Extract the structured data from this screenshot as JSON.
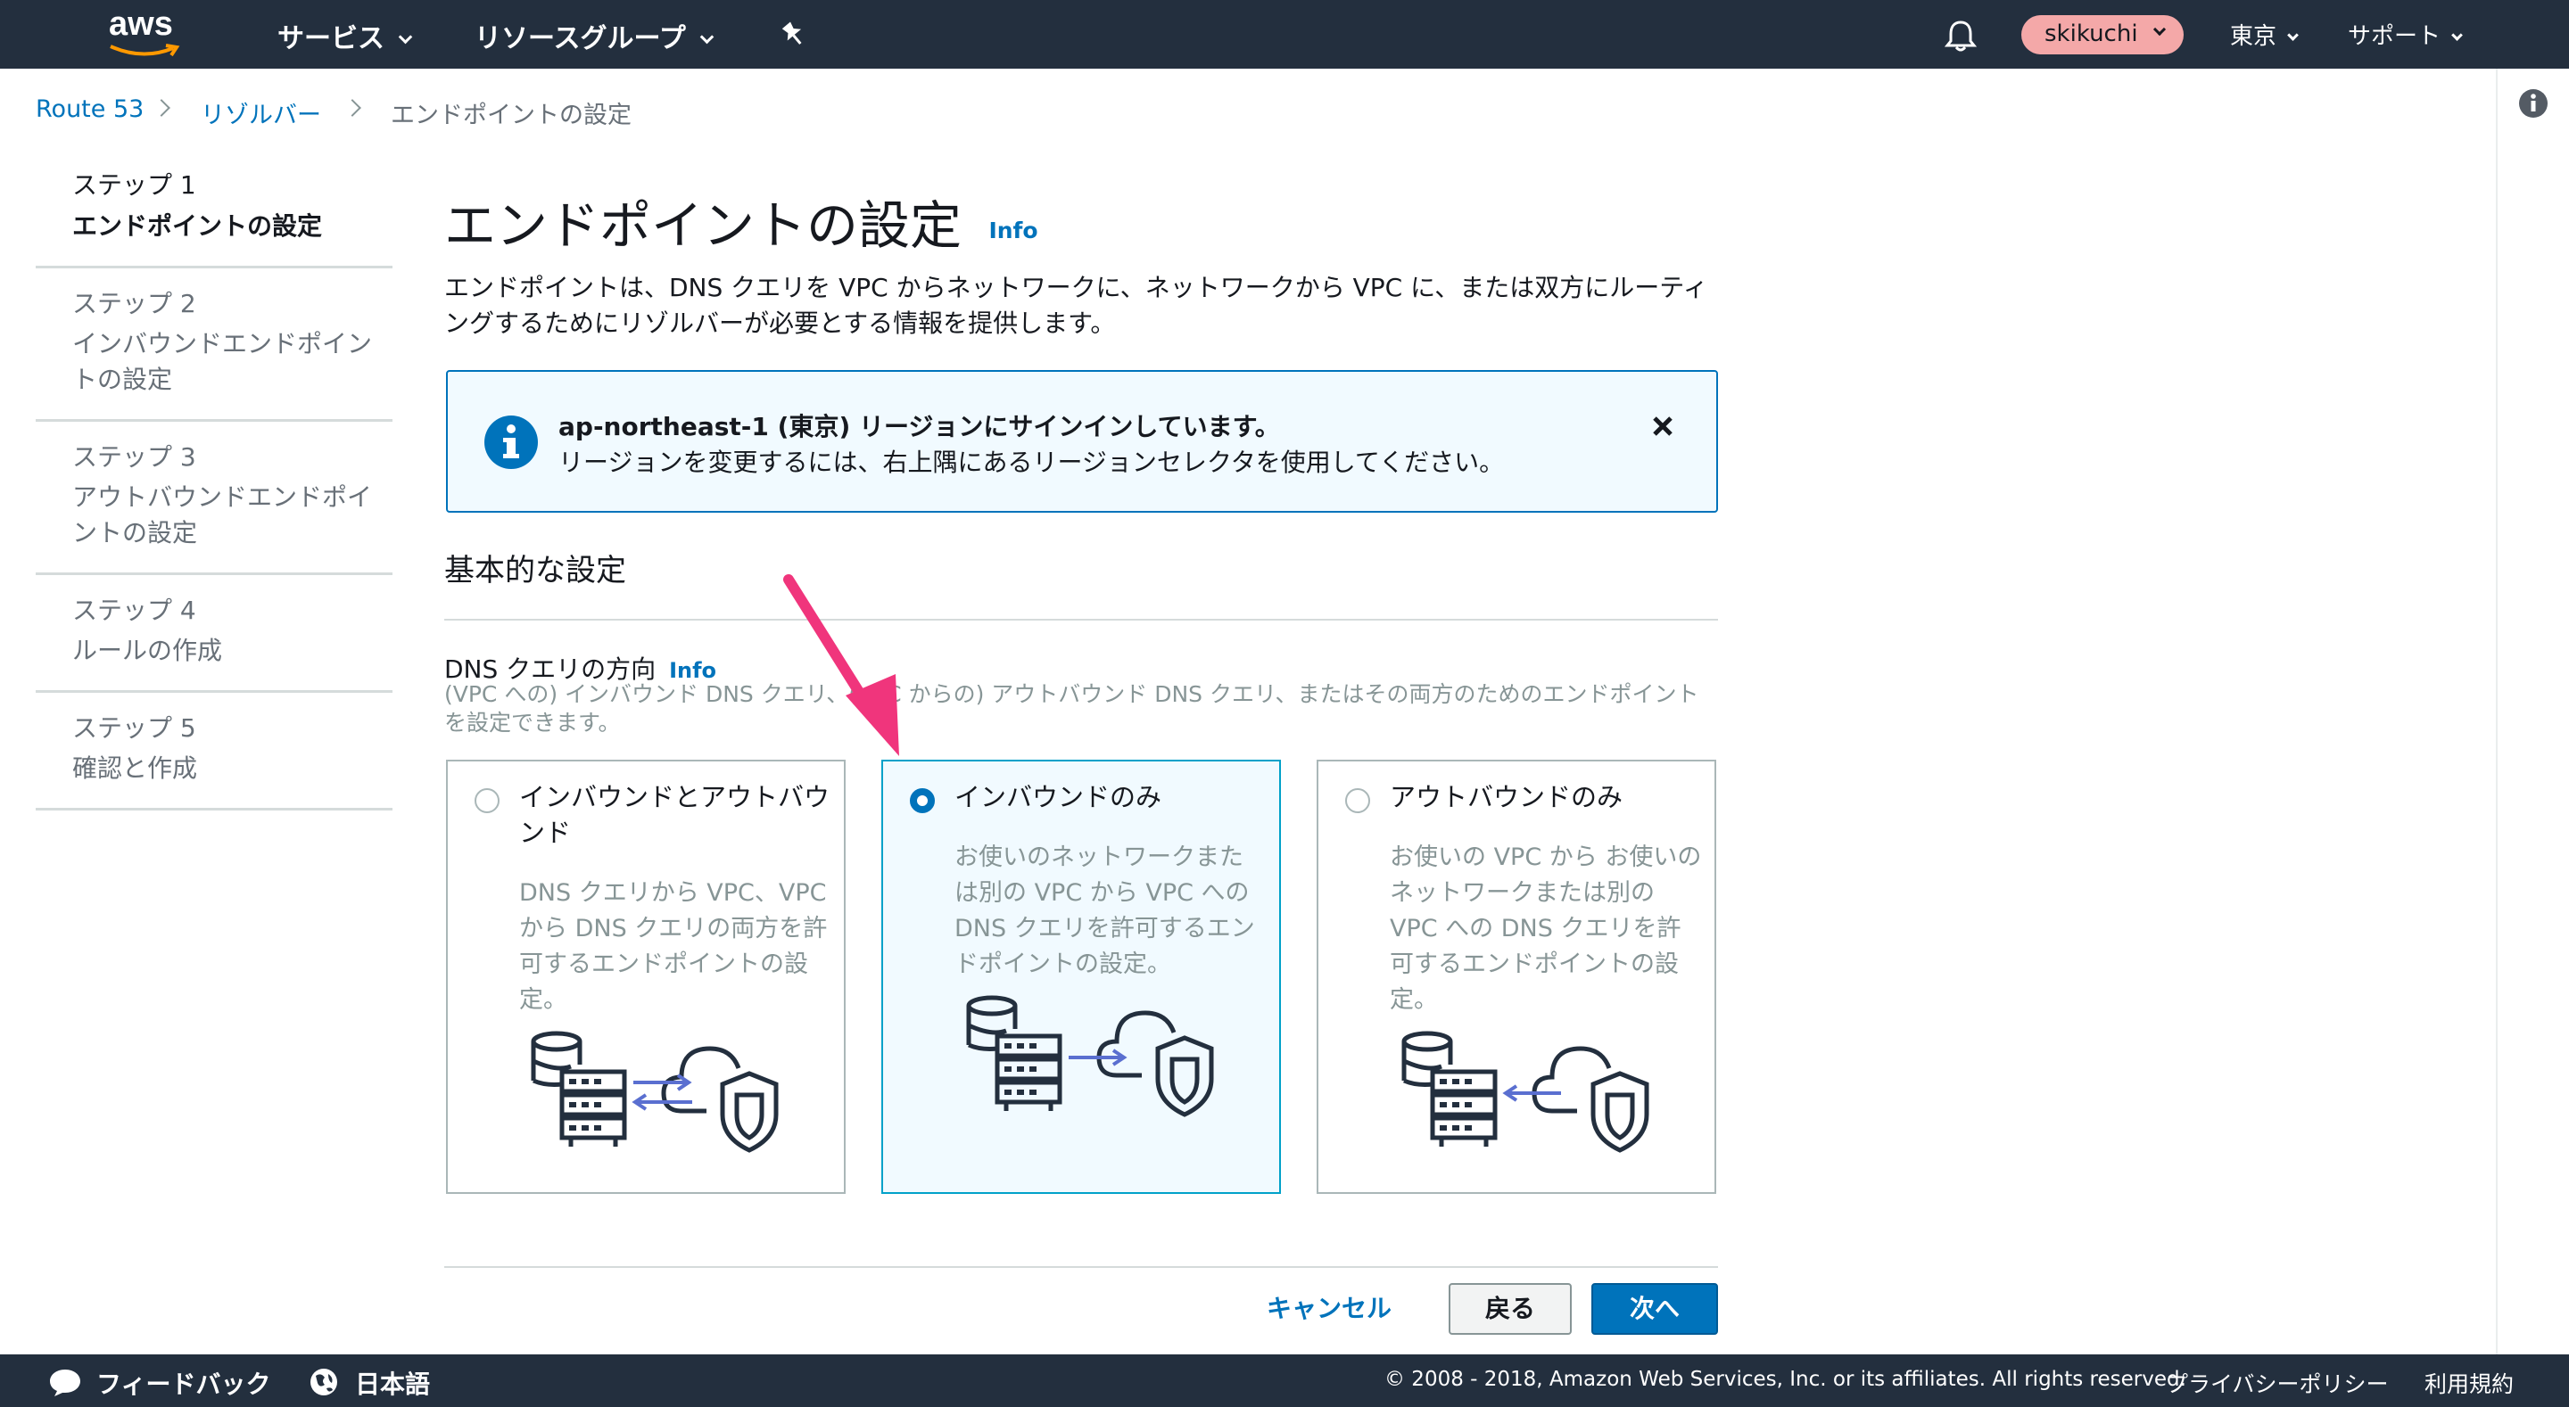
{
  "nav": {
    "logo": "aws",
    "services": "サービス",
    "resource_groups": "リソースグループ",
    "user": "skikuchi",
    "region": "東京",
    "support": "サポート"
  },
  "breadcrumb": {
    "items": [
      "Route 53",
      "リゾルバー",
      "エンドポイントの設定"
    ]
  },
  "steps": [
    {
      "num": "ステップ 1",
      "title": "エンドポイントの設定"
    },
    {
      "num": "ステップ 2",
      "title": "インバウンドエンドポイントの設定"
    },
    {
      "num": "ステップ 3",
      "title": "アウトバウンドエンドポイントの設定"
    },
    {
      "num": "ステップ 4",
      "title": "ルールの作成"
    },
    {
      "num": "ステップ 5",
      "title": "確認と作成"
    }
  ],
  "page": {
    "title": "エンドポイントの設定",
    "info": "Info",
    "description": "エンドポイントは、DNS クエリを VPC からネットワークに、ネットワークから VPC に、または双方にルーティングするためにリゾルバーが必要とする情報を提供します。"
  },
  "alert": {
    "title": "ap-northeast-1 (東京) リージョンにサインインしています。",
    "body": "リージョンを変更するには、右上隅にあるリージョンセレクタを使用してください。"
  },
  "basic_settings": {
    "heading": "基本的な設定",
    "direction_label": "DNS クエリの方向",
    "direction_info": "Info",
    "direction_help": "(VPC への) インバウンド DNS クエリ、(VPC からの) アウトバウンド DNS クエリ、またはその両方のためのエンドポイントを設定できます。"
  },
  "options": [
    {
      "title": "インバウンドとアウトバウンド",
      "description": "DNS クエリから VPC、VPC から DNS クエリの両方を許可するエンドポイントの設定。",
      "selected": false
    },
    {
      "title": "インバウンドのみ",
      "description": "お使いのネットワークまたは別の VPC から VPC への DNS クエリを許可するエンドポイントの設定。",
      "selected": true
    },
    {
      "title": "アウトバウンドのみ",
      "description": "お使いの VPC から お使いの ネットワークまたは別の VPC への DNS クエリを許可するエンドポイントの設定。",
      "selected": false
    }
  ],
  "actions": {
    "cancel": "キャンセル",
    "back": "戻る",
    "next": "次へ"
  },
  "footer": {
    "feedback": "フィードバック",
    "language": "日本語",
    "copyright": "© 2008 - 2018, Amazon Web Services, Inc. or its affiliates. All rights reserved.",
    "privacy": "プライバシーポリシー",
    "terms": "利用規約"
  },
  "colors": {
    "nav_bg": "#232f3e",
    "link": "#0073bb",
    "primary_button": "#0073bb",
    "selected_card_border": "#00a1c9",
    "annotation_arrow": "#f0357c",
    "user_badge": "#f4a8a8"
  }
}
